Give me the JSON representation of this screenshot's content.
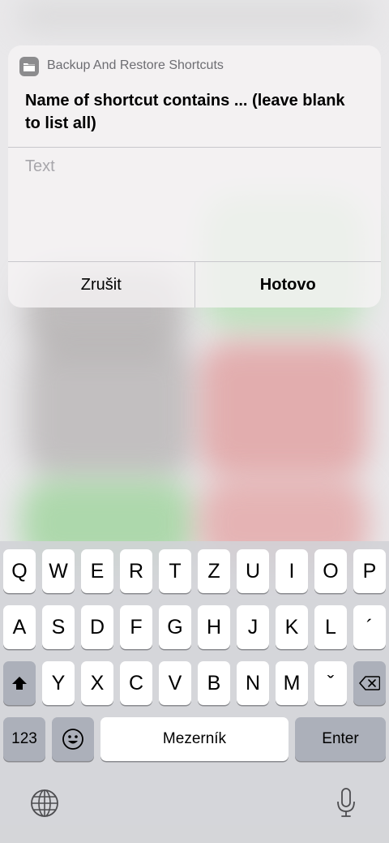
{
  "dialog": {
    "app_name": "Backup And Restore Shortcuts",
    "prompt": "Name of shortcut contains ... (leave blank to list all)",
    "input_placeholder": "Text",
    "input_value": "",
    "cancel_label": "Zrušit",
    "done_label": "Hotovo",
    "icon": "folder-icon"
  },
  "keyboard": {
    "row1": [
      "Q",
      "W",
      "E",
      "R",
      "T",
      "Z",
      "U",
      "I",
      "O",
      "P"
    ],
    "row2": [
      "A",
      "S",
      "D",
      "F",
      "G",
      "H",
      "J",
      "K",
      "L",
      "´"
    ],
    "row3": [
      "Y",
      "X",
      "C",
      "V",
      "B",
      "N",
      "M",
      "ˇ"
    ],
    "numbers_label": "123",
    "space_label": "Mezerník",
    "enter_label": "Enter",
    "icons": [
      "shift-icon",
      "backspace-icon",
      "emoji-icon",
      "globe-icon",
      "microphone-icon"
    ]
  }
}
